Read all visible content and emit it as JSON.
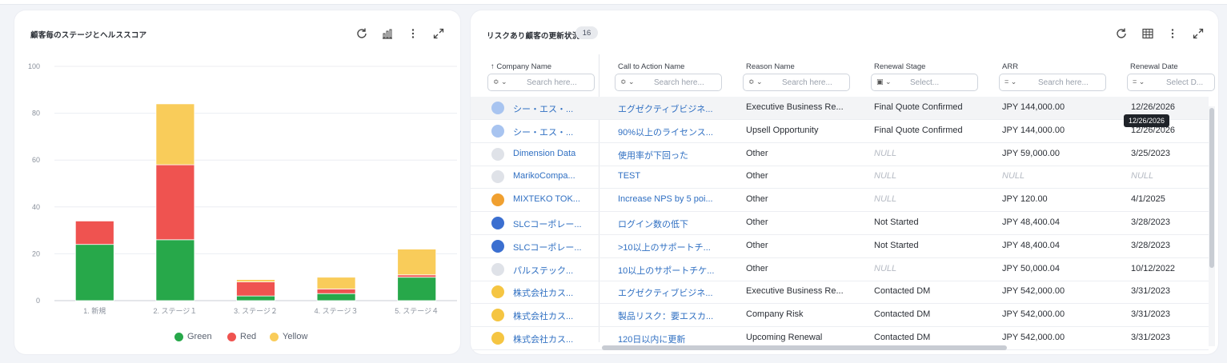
{
  "chart_panel": {
    "title": "顧客毎のステージとヘルススコア",
    "icons": [
      "refresh-icon",
      "chart-type-icon",
      "more-icon",
      "expand-icon"
    ]
  },
  "chart_data": {
    "type": "bar",
    "stacked": true,
    "categories": [
      "1. 新規",
      "2. ステージ１",
      "3. ステージ２",
      "4. ステージ３",
      "5. ステージ４"
    ],
    "series": [
      {
        "name": "Green",
        "color": "#27a84a",
        "values": [
          24,
          26,
          2,
          3,
          10
        ]
      },
      {
        "name": "Red",
        "color": "#ef5350",
        "values": [
          10,
          32,
          6,
          2,
          1
        ]
      },
      {
        "name": "Yellow",
        "color": "#f9cc5a",
        "values": [
          0,
          26,
          1,
          5,
          11
        ]
      }
    ],
    "ylim": [
      0,
      100
    ],
    "yticks": [
      "0",
      "20",
      "40",
      "60",
      "80",
      "100"
    ],
    "grid": true,
    "legend": "bottom"
  },
  "table_panel": {
    "title": "リスクあり顧客の更新状況",
    "count": "16",
    "icons": [
      "refresh-icon",
      "table-view-icon",
      "more-icon",
      "expand-icon"
    ],
    "columns": [
      {
        "label": "↑ Company Name",
        "op": "≎ ⌄",
        "placeholder": "Search here..."
      },
      {
        "label": "Call to Action Name",
        "op": "≎ ⌄",
        "placeholder": "Search here..."
      },
      {
        "label": "Reason Name",
        "op": "≎ ⌄",
        "placeholder": "Search here..."
      },
      {
        "label": "Renewal Stage",
        "op": "▣ ⌄",
        "placeholder": "Select..."
      },
      {
        "label": "ARR",
        "op": "= ⌄",
        "placeholder": "Search here..."
      },
      {
        "label": "Renewal Date",
        "op": "= ⌄",
        "placeholder": "Select D..."
      }
    ],
    "rows": [
      {
        "company": "シー・エス・...",
        "logo": "#a8c4f0",
        "cta": "エグゼクティブビジネ...",
        "reason": "Executive Business Re...",
        "stage": "Final Quote Confirmed",
        "arr": "JPY 144,000.00",
        "date": "12/26/2026"
      },
      {
        "company": "シー・エス・...",
        "logo": "#a8c4f0",
        "cta": "90%以上のライセンス...",
        "reason": "Upsell Opportunity",
        "stage": "Final Quote Confirmed",
        "arr": "JPY 144,000.00",
        "date": "12/26/2026"
      },
      {
        "company": "Dimension Data",
        "logo": "#dfe2e8",
        "cta": "使用率が下回った",
        "reason": "Other",
        "stage": "NULL",
        "arr": "JPY 59,000.00",
        "date": "3/25/2023"
      },
      {
        "company": "MarikoCompa...",
        "logo": "#dfe2e8",
        "cta": "TEST",
        "reason": "Other",
        "stage": "NULL",
        "arr": "NULL",
        "date": "NULL"
      },
      {
        "company": "MIXTEKO TOK...",
        "logo": "#f0a030",
        "cta": "Increase NPS by 5 poi...",
        "reason": "Other",
        "stage": "NULL",
        "arr": "JPY 120.00",
        "date": "4/1/2025"
      },
      {
        "company": "SLCコーポレー...",
        "logo": "#3b6fd0",
        "cta": "ログイン数の低下",
        "reason": "Other",
        "stage": "Not Started",
        "arr": "JPY 48,400.04",
        "date": "3/28/2023"
      },
      {
        "company": "SLCコーポレー...",
        "logo": "#3b6fd0",
        "cta": ">10以上のサポートチ...",
        "reason": "Other",
        "stage": "Not Started",
        "arr": "JPY 48,400.04",
        "date": "3/28/2023"
      },
      {
        "company": "パルステック...",
        "logo": "#dfe2e8",
        "cta": "10以上のサポートチケ...",
        "reason": "Other",
        "stage": "NULL",
        "arr": "JPY 50,000.04",
        "date": "10/12/2022"
      },
      {
        "company": "株式会社カス...",
        "logo": "#f5c542",
        "cta": "エグゼクティブビジネ...",
        "reason": "Executive Business Re...",
        "stage": "Contacted DM",
        "arr": "JPY 542,000.00",
        "date": "3/31/2023"
      },
      {
        "company": "株式会社カス...",
        "logo": "#f5c542",
        "cta": "製品リスク：要エスカ...",
        "reason": "Company Risk",
        "stage": "Contacted DM",
        "arr": "JPY 542,000.00",
        "date": "3/31/2023"
      },
      {
        "company": "株式会社カス...",
        "logo": "#f5c542",
        "cta": "120日以内に更新",
        "reason": "Upcoming Renewal",
        "stage": "Contacted DM",
        "arr": "JPY 542,000.00",
        "date": "3/31/2023"
      }
    ],
    "tooltip": "12/26/2026"
  }
}
